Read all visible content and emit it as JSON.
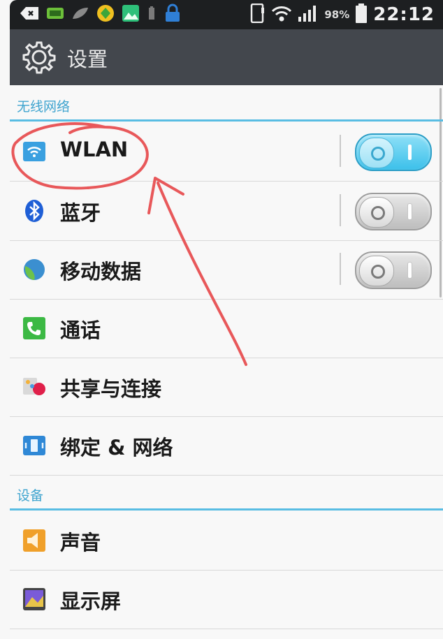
{
  "status_bar": {
    "battery_percent": "98%",
    "time": "22:12",
    "notification_icons": [
      "back-icon",
      "message-icon",
      "leaf-icon",
      "app-store-icon",
      "gallery-icon",
      "battery-small-icon",
      "lock-icon"
    ],
    "system_icons": [
      "phone-icon",
      "wifi-icon",
      "signal-icon",
      "battery-icon"
    ]
  },
  "header": {
    "title": "设置"
  },
  "sections": [
    {
      "title": "无线网络",
      "items": [
        {
          "label": "WLAN",
          "icon": "wifi-icon",
          "toggle": "on"
        },
        {
          "label": "蓝牙",
          "icon": "bluetooth-icon",
          "toggle": "off"
        },
        {
          "label": "移动数据",
          "icon": "mobile-data-icon",
          "toggle": "off"
        },
        {
          "label": "通话",
          "icon": "phone-icon"
        },
        {
          "label": "共享与连接",
          "icon": "share-icon"
        },
        {
          "label": "绑定 & 网络",
          "icon": "tethering-icon"
        }
      ]
    },
    {
      "title": "设备",
      "items": [
        {
          "label": "声音",
          "icon": "sound-icon"
        },
        {
          "label": "显示屏",
          "icon": "display-icon"
        }
      ]
    }
  ],
  "colors": {
    "status_bar_bg": "#1d1f21",
    "title_bar_bg": "#43474d",
    "section_accent": "#59bde3",
    "annotation": "#e8585a"
  }
}
